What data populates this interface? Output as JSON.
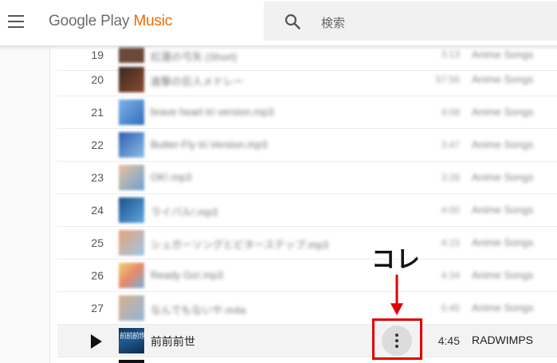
{
  "header": {
    "menu_icon": "hamburger-menu-icon",
    "logo_google": "Google",
    "logo_play": "Play",
    "logo_music": "Music",
    "search_icon": "search-icon",
    "search_placeholder": "検索"
  },
  "tracks": [
    {
      "number": "19",
      "title": "紅蓮の弓矢 (Short)",
      "duration": "3:13",
      "artist": "Anime Songs"
    },
    {
      "number": "20",
      "title": "進撃の巨人メドレー",
      "duration": "57:56",
      "artist": "Anime Songs"
    },
    {
      "number": "21",
      "title": "brave heart tri version.mp3",
      "duration": "4:08",
      "artist": "Anime Songs"
    },
    {
      "number": "22",
      "title": "Butter-Fly tri.Version.mp3",
      "duration": "3:47",
      "artist": "Anime Songs"
    },
    {
      "number": "23",
      "title": "OK!.mp3",
      "duration": "3:28",
      "artist": "Anime Songs"
    },
    {
      "number": "24",
      "title": "ライバル!.mp3",
      "duration": "4:00",
      "artist": "Anime Songs"
    },
    {
      "number": "25",
      "title": "シュガーソングとビターステップ.mp3",
      "duration": "4:15",
      "artist": "Anime Songs"
    },
    {
      "number": "26",
      "title": "Ready Go!.mp3",
      "duration": "4:34",
      "artist": "Anime Songs"
    },
    {
      "number": "27",
      "title": "なんでもないや.m4a",
      "duration": "5:45",
      "artist": "Anime Songs"
    }
  ],
  "current_track": {
    "play_icon": "play-icon",
    "art_text": "前前前世",
    "title": "前前前世",
    "more_icon": "more-vertical-icon",
    "duration": "4:45",
    "artist": "RADWIMPS"
  },
  "annotation": {
    "callout": "コレ",
    "arrow_icon": "arrow-down-icon",
    "color": "#e00000"
  },
  "colors": {
    "accent_orange": "#ef6c00",
    "search_bg": "#f1f1f1",
    "current_row_bg": "#f3f3f3"
  }
}
